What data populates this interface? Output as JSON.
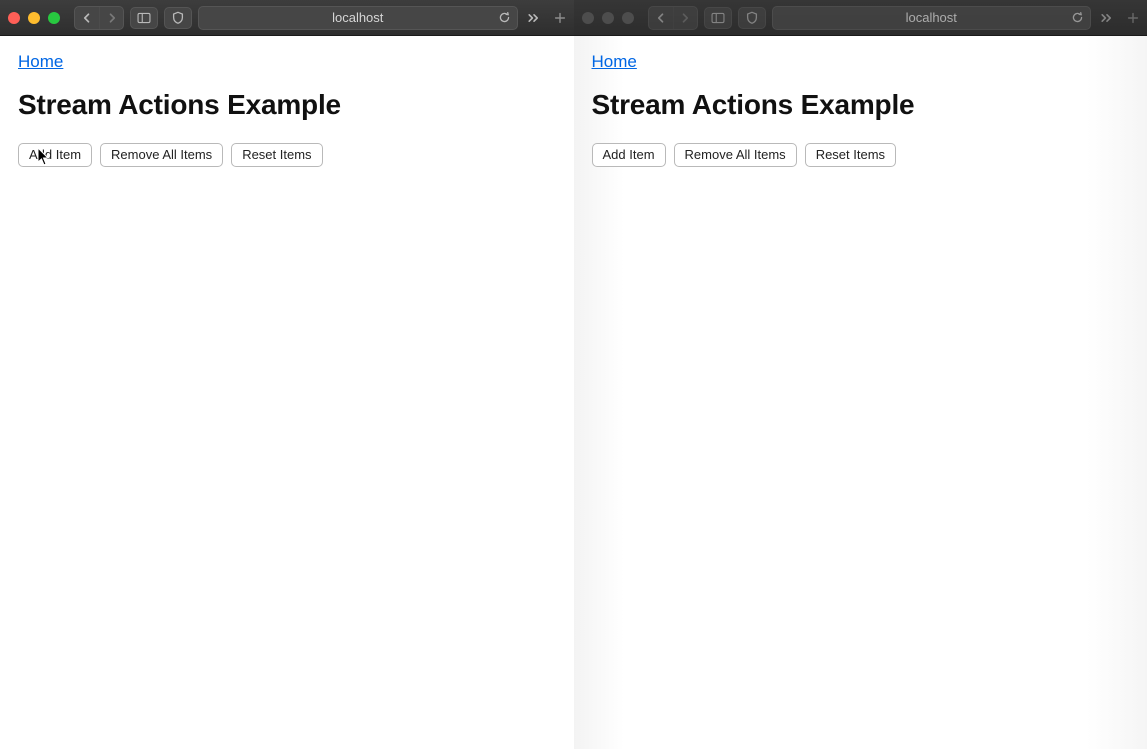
{
  "leftWindow": {
    "toolbar": {
      "address": "localhost"
    },
    "page": {
      "homeLink": "Home",
      "title": "Stream Actions Example",
      "buttons": {
        "add": "Add Item",
        "removeAll": "Remove All Items",
        "reset": "Reset Items"
      }
    }
  },
  "rightWindow": {
    "toolbar": {
      "address": "localhost"
    },
    "page": {
      "homeLink": "Home",
      "title": "Stream Actions Example",
      "buttons": {
        "add": "Add Item",
        "removeAll": "Remove All Items",
        "reset": "Reset Items"
      }
    }
  }
}
